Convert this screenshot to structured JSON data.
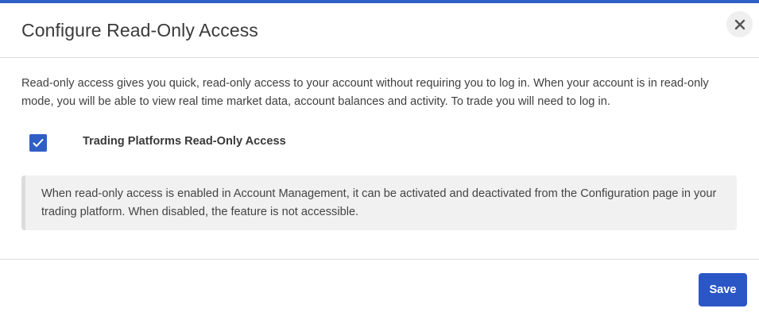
{
  "dialog": {
    "title": "Configure Read-Only Access",
    "close_icon": "close-icon"
  },
  "body": {
    "description": "Read-only access gives you quick, read-only access to your account without requiring you to log in. When your account is in read-only mode, you will be able to view real time market data, account balances and activity. To trade you will need to log in.",
    "option": {
      "label": "Trading Platforms Read-Only Access",
      "checked": true,
      "icon": "checkmark-icon"
    },
    "info": "When read-only access is enabled in Account Management, it can be activated and deactivated from the Configuration page in your trading platform. When disabled, the feature is not accessible."
  },
  "footer": {
    "save_label": "Save"
  },
  "colors": {
    "accent": "#2f5fc4",
    "button": "#2a56c6",
    "info_background": "#f1f1f1"
  }
}
